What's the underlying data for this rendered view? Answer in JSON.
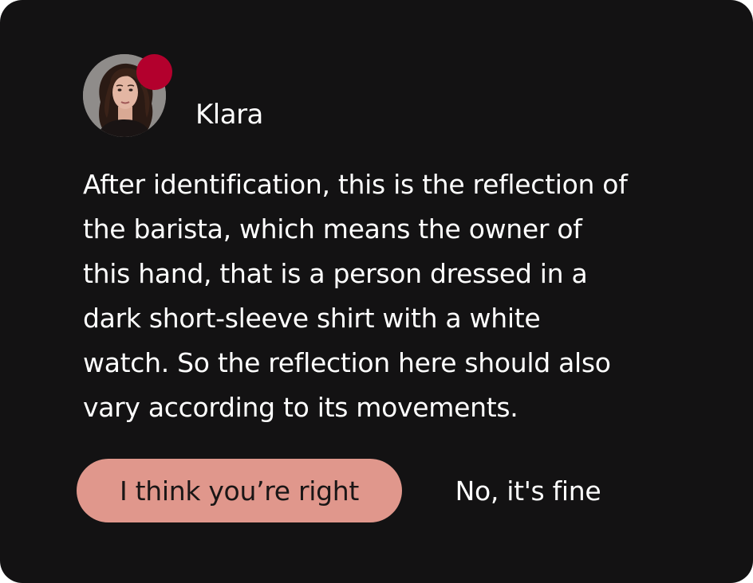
{
  "sender": {
    "name": "Klara",
    "avatar_icon": "user-avatar-photo",
    "presence_color": "#b3002d"
  },
  "message": {
    "lines": [
      "After identification, this is the reflection of",
      "the barista, which means the owner of",
      "this hand, that is a person dressed in a",
      "dark short-sleeve shirt with a white",
      "watch. So the reflection here should also",
      "vary according to its movements."
    ]
  },
  "actions": {
    "primary_label": "I think you’re right",
    "secondary_label": "No, it's fine"
  },
  "colors": {
    "card_background": "#131213",
    "primary_button": "#e0978c",
    "text": "#ffffff"
  }
}
